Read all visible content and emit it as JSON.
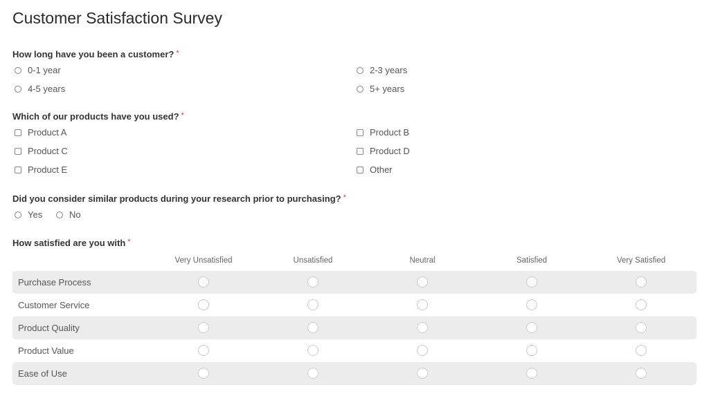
{
  "title": "Customer Satisfaction Survey",
  "required_marker": "*",
  "accent_required_color": "#e03b3b",
  "q1": {
    "label": "How long have you been a customer?",
    "options": [
      "0-1 year",
      "2-3 years",
      "4-5 years",
      "5+ years"
    ]
  },
  "q2": {
    "label": "Which of our products have you used?",
    "options": [
      "Product A",
      "Product B",
      "Product C",
      "Product D",
      "Product E",
      "Other"
    ]
  },
  "q3": {
    "label": "Did you consider similar products during your research prior to purchasing?",
    "options": [
      "Yes",
      "No"
    ]
  },
  "q4": {
    "label": "How satisfied are you with",
    "columns": [
      "Very Unsatisfied",
      "Unsatisfied",
      "Neutral",
      "Satisfied",
      "Very Satisfied"
    ],
    "rows": [
      "Purchase Process",
      "Customer Service",
      "Product Quality",
      "Product Value",
      "Ease of Use"
    ]
  }
}
